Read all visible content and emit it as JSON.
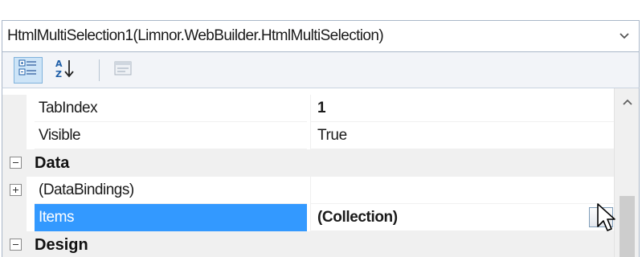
{
  "object_selector": {
    "value": "HtmlMultiSelection1(Limnor.WebBuilder.HtmlMultiSelection)"
  },
  "toolbar": {
    "buttons": [
      {
        "icon": "categorized-icon",
        "active": true
      },
      {
        "icon": "alphabetical-sort-icon",
        "active": false
      },
      {
        "icon": "property-pages-icon",
        "active": false
      }
    ]
  },
  "grid": {
    "rows": [
      {
        "type": "property",
        "name": "TabIndex",
        "value": "1",
        "bold": true
      },
      {
        "type": "property",
        "name": "Visible",
        "value": "True",
        "bold": false
      },
      {
        "type": "category",
        "label": "Data",
        "expanded": true
      },
      {
        "type": "property",
        "name": "(DataBindings)",
        "value": "",
        "expandable": true
      },
      {
        "type": "property",
        "name": "Items",
        "value": "(Collection)",
        "bold": true,
        "selected": true,
        "ellipsis": "..."
      },
      {
        "type": "category",
        "label": "Design",
        "expanded": true
      }
    ]
  },
  "colors": {
    "selection": "#3399ff",
    "category_bg": "#f0f0f0",
    "toolbar_active": "#cde4f7"
  }
}
